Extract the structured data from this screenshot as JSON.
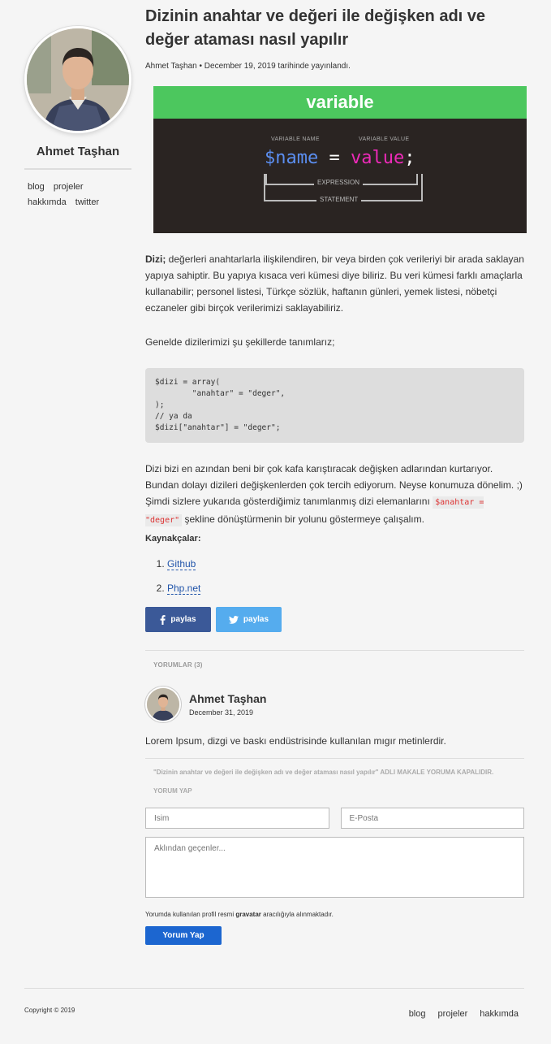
{
  "sidebar": {
    "author_name": "Ahmet Taşhan",
    "nav": [
      "blog",
      "projeler",
      "hakkımda",
      "twitter"
    ]
  },
  "post": {
    "title": "Dizinin anahtar ve değeri ile değişken adı ve değer ataması nasıl yapılır",
    "meta": "Ahmet Taşhan • December 19, 2019 tarihinde yayınlandı.",
    "hero": {
      "heading": "variable",
      "label_name": "VARIABLE NAME",
      "label_value": "VARIABLE VALUE",
      "code_name": "$name",
      "code_eq": " = ",
      "code_value": "value",
      "code_semi": ";",
      "expression": "EXPRESSION",
      "statement": "STATEMENT"
    },
    "intro_bold": "Dizi;",
    "intro_text": " değerleri anahtarlarla ilişkilendiren, bir veya birden çok verileriyi bir arada saklayan yapıya sahiptir. Bu yapıya kısaca veri kümesi diye biliriz. Bu veri kümesi farklı amaçlarla kullanabilir; personel listesi, Türkçe sözlük, haftanın günleri, yemek listesi, nöbetçi eczaneler gibi birçok verilerimizi saklayabiliriz.",
    "define_text": "Genelde dizilerimizi şu şekillerde tanımlarız;",
    "code": "$dizi = array(\n        \"anahtar\" = \"deger\",\n);\n// ya da\n$dizi[\"anahtar\"] = \"deger\";",
    "body_text": "Dizi bizi en azından beni bir çok kafa karıştıracak değişken adlarından kurtarıyor. Bundan dolayı dizileri değişkenlerden çok tercih ediyorum. Neyse konumuza dönelim. ;) Şimdi sizlere yukarıda gösterdiğimiz tanımlanmış dizi elemanlarını ",
    "body_code": "$anahtar = \"deger\"",
    "body_tail": " şekline dönüştürmenin bir yolunu göstermeye çalışalım.",
    "sources_title": "Kaynakçalar:",
    "sources": [
      "Github",
      "Php.net"
    ],
    "share_fb": "paylas",
    "share_tw": "paylas"
  },
  "comments": {
    "header": "YORUMLAR (3)",
    "items": [
      {
        "name": "Ahmet Taşhan",
        "date": "December 31, 2019",
        "text": "Lorem Ipsum, dizgi ve baskı endüstrisinde kullanılan mıgır metinlerdir."
      }
    ],
    "closed": "\"Dizinin anahtar ve değeri ile değişken adı ve değer ataması nasıl yapılır\" ADLI MAKALE YORUMA KAPALIDIR.",
    "reply_header": "YORUM YAP",
    "name_placeholder": "İsim",
    "email_placeholder": "E-Posta",
    "message_placeholder": "Aklından geçenler...",
    "note_pre": "Yorumda kullanılan profil resmi ",
    "note_bold": "gravatar",
    "note_post": " aracılığıyla alınmaktadır.",
    "submit": "Yorum Yap"
  },
  "footer": {
    "copyright": "Copyright © 2019",
    "nav": [
      "blog",
      "projeler",
      "hakkımda"
    ]
  },
  "colors": {
    "hero_green": "#4cc75e",
    "facebook": "#3b5998",
    "twitter": "#55acee",
    "submit_blue": "#1c66d0"
  }
}
